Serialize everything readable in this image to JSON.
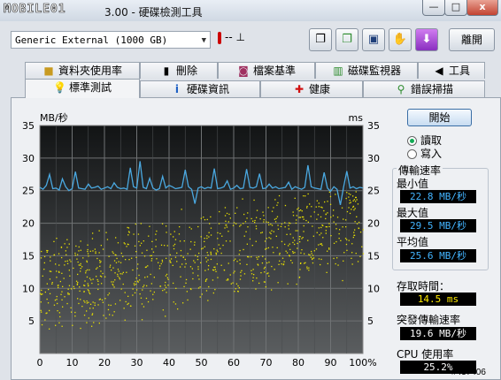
{
  "window": {
    "logo_text": "MOBILE01",
    "title": "3.00 - 硬碟檢測工具",
    "min_label": "—",
    "max_label": "□",
    "close_label": "x"
  },
  "toolbar": {
    "drive": "Generic External  (1000 GB)",
    "temperature": "-- ⊥",
    "exit_label": "離開",
    "icons": [
      "copy-icon",
      "copy-screenshot-icon",
      "save-icon",
      "settings-icon",
      "download-icon"
    ]
  },
  "tabs_top": [
    {
      "label": "資料夾使用率",
      "icon": "folder-icon"
    },
    {
      "label": "刪除",
      "icon": "trash-icon"
    },
    {
      "label": "檔案基準",
      "icon": "file-benchmark-icon"
    },
    {
      "label": "磁碟監視器",
      "icon": "monitor-icon"
    },
    {
      "label": "工具",
      "icon": "speaker-icon"
    }
  ],
  "tabs_bottom": [
    {
      "label": "標準測試",
      "icon": "bulb-icon",
      "active": true
    },
    {
      "label": "硬碟資訊",
      "icon": "info-icon"
    },
    {
      "label": "健康",
      "icon": "health-cross-icon"
    },
    {
      "label": "錯誤掃描",
      "icon": "magnifier-icon"
    }
  ],
  "side": {
    "start_label": "開始",
    "read_label": "讀取",
    "write_label": "寫入",
    "read_selected": true,
    "transfer_rate_label": "傳輸速率",
    "min_label": "最小值",
    "min_value": "22.8 MB/秒",
    "max_label": "最大值",
    "max_value": "29.5 MB/秒",
    "avg_label": "平均值",
    "avg_value": "25.6 MB/秒",
    "access_time_label": "存取時間：",
    "access_time_value": "14.5 ms",
    "burst_label": "突發傳輸速率",
    "burst_value": "19.6 MB/秒",
    "cpu_label": "CPU 使用率",
    "cpu_value": "25.2%"
  },
  "watermark": "#437406",
  "chart_data": {
    "type": "line",
    "y_left_label": "MB/秒",
    "y_right_label": "ms",
    "ylim_left": [
      0,
      35
    ],
    "ylim_right": [
      0,
      35
    ],
    "y_ticks_left": [
      5,
      10,
      15,
      20,
      25,
      30,
      35
    ],
    "y_ticks_right": [
      5,
      10,
      15,
      20,
      25,
      30,
      35
    ],
    "x_ticks": [
      "0",
      "10",
      "20",
      "30",
      "40",
      "50",
      "60",
      "70",
      "80",
      "90",
      "100%"
    ],
    "grid": true,
    "series": [
      {
        "kind": "line",
        "color": "#4aa8e0",
        "x": [
          0,
          1,
          2,
          3,
          4,
          5,
          6,
          7,
          8,
          9,
          10,
          11,
          12,
          13,
          14,
          15,
          16,
          17,
          18,
          19,
          20,
          21,
          22,
          23,
          24,
          25,
          26,
          27,
          28,
          29,
          30,
          31,
          32,
          33,
          34,
          35,
          36,
          37,
          38,
          39,
          40,
          41,
          42,
          43,
          44,
          45,
          46,
          47,
          48,
          49,
          50,
          51,
          52,
          53,
          54,
          55,
          56,
          57,
          58,
          59,
          60,
          61,
          62,
          63,
          64,
          65,
          66,
          67,
          68,
          69,
          70,
          71,
          72,
          73,
          74,
          75,
          76,
          77,
          78,
          79,
          80,
          81,
          82,
          83,
          84,
          85,
          86,
          87,
          88,
          89,
          90,
          91,
          92,
          93,
          94,
          95,
          96,
          97,
          98,
          99,
          100
        ],
        "y": [
          25.5,
          25.2,
          25.8,
          27.5,
          25.3,
          25.4,
          25.1,
          26.8,
          25.6,
          25.0,
          25.3,
          27.9,
          25.4,
          25.3,
          25.2,
          26.0,
          25.4,
          25.5,
          25.7,
          25.2,
          25.4,
          25.6,
          25.3,
          26.2,
          25.5,
          25.3,
          25.4,
          25.2,
          28.5,
          25.6,
          25.4,
          29.5,
          25.5,
          25.3,
          26.9,
          25.4,
          25.1,
          25.3,
          27.2,
          25.4,
          25.8,
          25.6,
          25.3,
          25.4,
          25.5,
          28.2,
          25.6,
          25.2,
          23.0,
          25.4,
          25.6,
          25.3,
          25.5,
          25.4,
          28.4,
          25.3,
          25.4,
          25.6,
          26.5,
          25.2,
          25.4,
          25.8,
          25.3,
          25.4,
          28.3,
          25.5,
          25.4,
          25.6,
          27.6,
          25.3,
          25.4,
          26.0,
          25.4,
          25.6,
          25.3,
          25.4,
          25.5,
          26.3,
          25.2,
          25.6,
          25.4,
          25.2,
          25.5,
          28.9,
          25.6,
          25.4,
          25.3,
          25.2,
          27.8,
          25.4,
          24.9,
          25.6,
          25.2,
          22.8,
          25.5,
          28.0,
          25.4,
          25.6,
          25.3,
          25.5,
          25.4
        ]
      },
      {
        "kind": "scatter",
        "color": "#e8e000",
        "name": "access time",
        "trend": [
          10,
          20
        ]
      }
    ]
  }
}
